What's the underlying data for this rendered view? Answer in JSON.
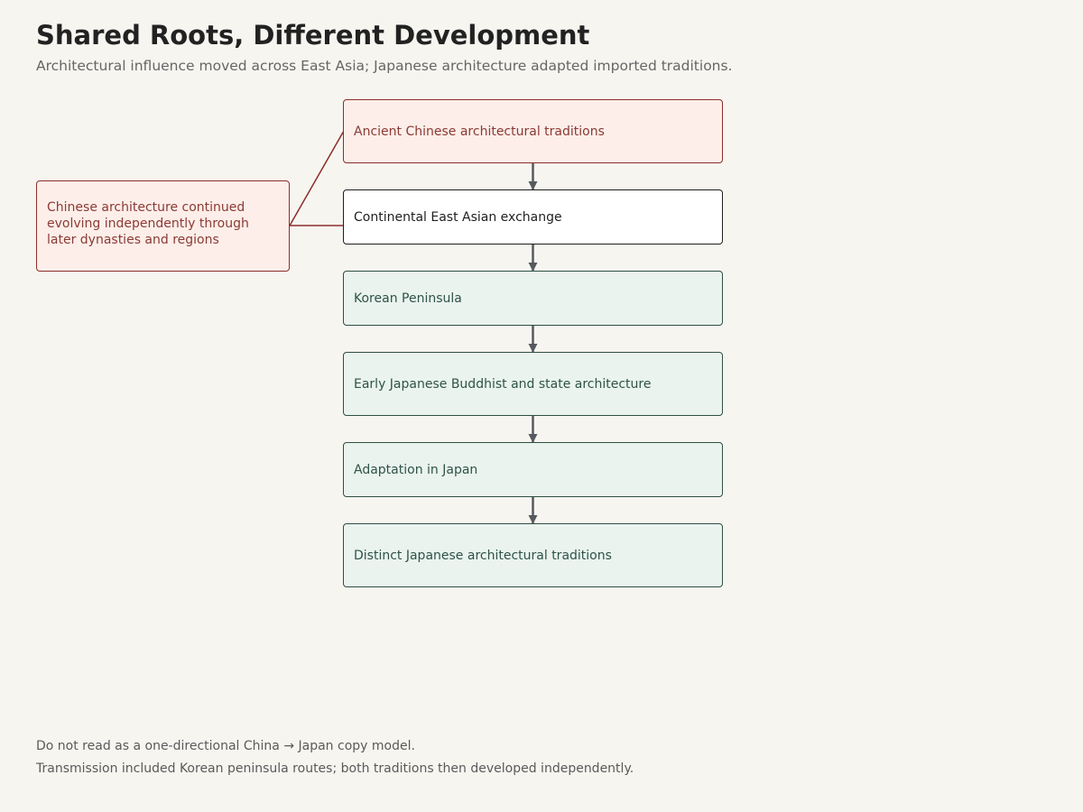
{
  "title": "Shared Roots, Different Development",
  "subtitle": "Architectural influence moved across East Asia; Japanese architecture adapted imported traditions.",
  "nodes": {
    "ancient_chinese": "Ancient Chinese architectural traditions",
    "continental_exchange": "Continental East Asian exchange",
    "korean_peninsula": "Korean Peninsula",
    "early_japanese": "Early Japanese Buddhist and state architecture",
    "adaptation_japan": "Adaptation in Japan",
    "distinct_japanese": "Distinct Japanese architectural traditions",
    "chinese_continued": "Chinese architecture continued evolving independently through later dynasties and regions"
  },
  "footnotes": {
    "line1": "Do not read as a one-directional China → Japan copy model.",
    "line2": "Transmission included Korean peninsula routes; both traditions then developed independently."
  },
  "colors": {
    "red_fill": "#fdeee9",
    "red_stroke": "#8b2e2a",
    "green_fill": "#eaf3ee",
    "green_stroke": "#2f4f45",
    "arrow": "#555a5e",
    "background": "#f7f5f0"
  }
}
